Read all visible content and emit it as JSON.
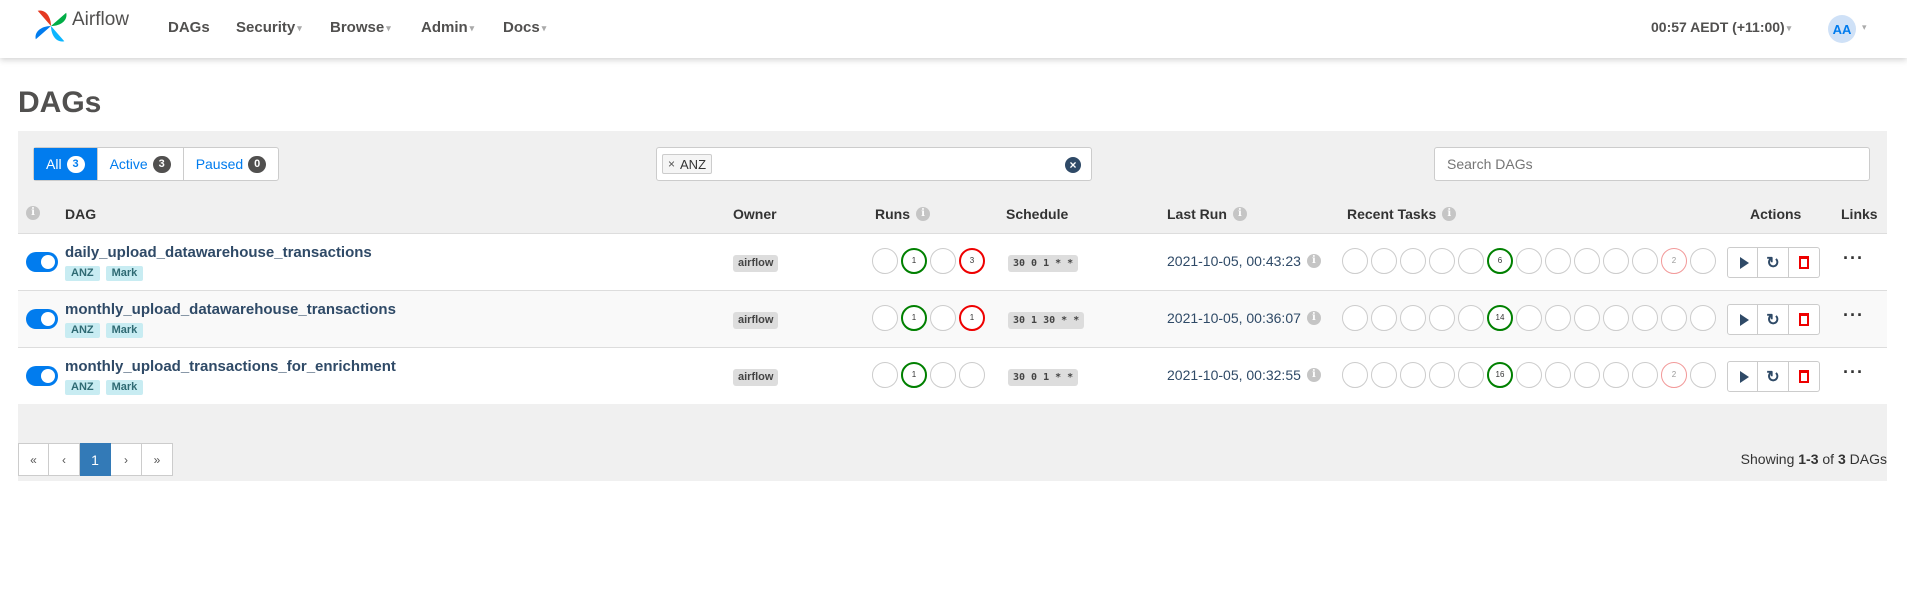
{
  "navbar": {
    "brand": "Airflow",
    "items": [
      {
        "label": "DAGs",
        "dropdown": false
      },
      {
        "label": "Security",
        "dropdown": true
      },
      {
        "label": "Browse",
        "dropdown": true
      },
      {
        "label": "Admin",
        "dropdown": true
      },
      {
        "label": "Docs",
        "dropdown": true
      }
    ],
    "clock": "00:57 AEDT (+11:00)",
    "avatar": "AA"
  },
  "page": {
    "title": "DAGs"
  },
  "filters": {
    "all": {
      "label": "All",
      "count": "3"
    },
    "active": {
      "label": "Active",
      "count": "3"
    },
    "paused": {
      "label": "Paused",
      "count": "0"
    }
  },
  "tag_filter": {
    "remove": "×",
    "value": "ANZ",
    "clear": "×"
  },
  "search": {
    "placeholder": "Search DAGs"
  },
  "columns": {
    "dag": "DAG",
    "owner": "Owner",
    "runs": "Runs",
    "schedule": "Schedule",
    "last_run": "Last Run",
    "recent_tasks": "Recent Tasks",
    "actions": "Actions",
    "links": "Links"
  },
  "dags": [
    {
      "dag_id": "daily_upload_datawarehouse_transactions",
      "tags": [
        "ANZ",
        "Mark"
      ],
      "owner": "airflow",
      "runs": [
        "",
        "1",
        "",
        "3"
      ],
      "schedule": "30 0 1 * *",
      "last_run": "2021-10-05, 00:43:23",
      "recent_tasks": [
        "",
        "",
        "",
        "",
        "",
        "6",
        "",
        "",
        "",
        "",
        "",
        "2",
        ""
      ]
    },
    {
      "dag_id": "monthly_upload_datawarehouse_transactions",
      "tags": [
        "ANZ",
        "Mark"
      ],
      "owner": "airflow",
      "runs": [
        "",
        "1",
        "",
        "1"
      ],
      "schedule": "30 1 30 * *",
      "last_run": "2021-10-05, 00:36:07",
      "recent_tasks": [
        "",
        "",
        "",
        "",
        "",
        "14",
        "",
        "",
        "",
        "",
        "",
        "",
        ""
      ]
    },
    {
      "dag_id": "monthly_upload_transactions_for_enrichment",
      "tags": [
        "ANZ",
        "Mark"
      ],
      "owner": "airflow",
      "runs": [
        "",
        "1",
        "",
        ""
      ],
      "schedule": "30 0 1 * *",
      "last_run": "2021-10-05, 00:32:55",
      "recent_tasks": [
        "",
        "",
        "",
        "",
        "",
        "16",
        "",
        "",
        "",
        "",
        "",
        "2",
        ""
      ]
    }
  ],
  "pagination": {
    "first": "«",
    "prev": "‹",
    "current": "1",
    "next": "›",
    "last": "»"
  },
  "showing": {
    "prefix": "Showing ",
    "range": "1-3",
    "mid": " of ",
    "total": "3",
    "suffix": " DAGs"
  },
  "colors": {
    "accent": "#017cee",
    "success": "#008000",
    "failed": "#e00000",
    "link": "#2f4a67"
  }
}
